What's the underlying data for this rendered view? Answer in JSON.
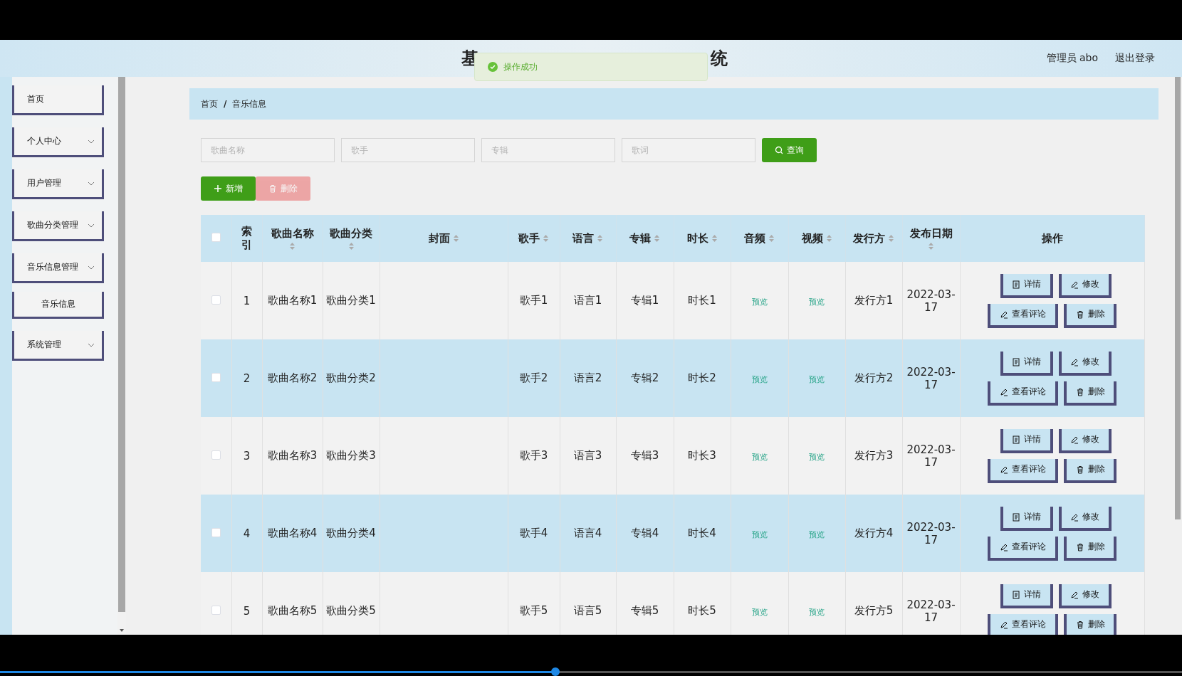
{
  "header": {
    "title_start": "基",
    "title_end": "统",
    "user": "管理员 abo",
    "logout": "退出登录"
  },
  "toast": {
    "message": "操作成功"
  },
  "sidebar": {
    "items": [
      {
        "label": "首页",
        "kind": "link"
      },
      {
        "label": "个人中心",
        "kind": "menu"
      },
      {
        "label": "用户管理",
        "kind": "menu"
      },
      {
        "label": "歌曲分类管理",
        "kind": "menu"
      },
      {
        "label": "音乐信息管理",
        "kind": "menu",
        "children": [
          {
            "label": "音乐信息",
            "kind": "sub"
          }
        ]
      },
      {
        "label": "系统管理",
        "kind": "menu"
      }
    ]
  },
  "breadcrumb": {
    "items": [
      "首页",
      "音乐信息"
    ],
    "separator": "/"
  },
  "search": {
    "fields": [
      {
        "placeholder": "歌曲名称"
      },
      {
        "placeholder": "歌手"
      },
      {
        "placeholder": "专辑"
      },
      {
        "placeholder": "歌词"
      }
    ],
    "button": "查询"
  },
  "actions": [
    {
      "label": "新增",
      "kind": "add",
      "disabled": false
    },
    {
      "label": "删除",
      "kind": "delete",
      "disabled": true
    }
  ],
  "table": {
    "header_checked": false,
    "columns": [
      {
        "label": "索引",
        "sortable": false
      },
      {
        "label": "歌曲名称",
        "sortable": true
      },
      {
        "label": "歌曲分类",
        "sortable": true
      },
      {
        "label": "封面",
        "sortable": true
      },
      {
        "label": "歌手",
        "sortable": true
      },
      {
        "label": "语言",
        "sortable": true
      },
      {
        "label": "专辑",
        "sortable": true
      },
      {
        "label": "时长",
        "sortable": true
      },
      {
        "label": "音频",
        "sortable": true
      },
      {
        "label": "视频",
        "sortable": true
      },
      {
        "label": "发行方",
        "sortable": true
      },
      {
        "label": "发布日期",
        "sortable": true
      },
      {
        "label": "操作",
        "sortable": false
      }
    ],
    "rows": [
      {
        "checked": false,
        "cells": [
          "1",
          "歌曲名称1",
          "歌曲分类1",
          "",
          "歌手1",
          "语言1",
          "专辑1",
          "时长1",
          "预览",
          "预览",
          "发行方1",
          "2022-03-17"
        ],
        "actions": [
          {
            "label": "详情",
            "kind": "detail"
          },
          {
            "label": "修改",
            "kind": "edit"
          },
          {
            "label": "查看评论",
            "kind": "comment"
          },
          {
            "label": "删除",
            "kind": "delete"
          }
        ]
      },
      {
        "checked": false,
        "cells": [
          "2",
          "歌曲名称2",
          "歌曲分类2",
          "",
          "歌手2",
          "语言2",
          "专辑2",
          "时长2",
          "预览",
          "预览",
          "发行方2",
          "2022-03-17"
        ],
        "actions": [
          {
            "label": "详情",
            "kind": "detail"
          },
          {
            "label": "修改",
            "kind": "edit"
          },
          {
            "label": "查看评论",
            "kind": "comment"
          },
          {
            "label": "删除",
            "kind": "delete"
          }
        ]
      },
      {
        "checked": false,
        "cells": [
          "3",
          "歌曲名称3",
          "歌曲分类3",
          "",
          "歌手3",
          "语言3",
          "专辑3",
          "时长3",
          "预览",
          "预览",
          "发行方3",
          "2022-03-17"
        ],
        "actions": [
          {
            "label": "详情",
            "kind": "detail"
          },
          {
            "label": "修改",
            "kind": "edit"
          },
          {
            "label": "查看评论",
            "kind": "comment"
          },
          {
            "label": "删除",
            "kind": "delete"
          }
        ]
      },
      {
        "checked": false,
        "cells": [
          "4",
          "歌曲名称4",
          "歌曲分类4",
          "",
          "歌手4",
          "语言4",
          "专辑4",
          "时长4",
          "预览",
          "预览",
          "发行方4",
          "2022-03-17"
        ],
        "actions": [
          {
            "label": "详情",
            "kind": "detail"
          },
          {
            "label": "修改",
            "kind": "edit"
          },
          {
            "label": "查看评论",
            "kind": "comment"
          },
          {
            "label": "删除",
            "kind": "delete"
          }
        ]
      },
      {
        "checked": false,
        "cells": [
          "5",
          "歌曲名称5",
          "歌曲分类5",
          "",
          "歌手5",
          "语言5",
          "专辑5",
          "时长5",
          "预览",
          "预览",
          "发行方5",
          "2022-03-17"
        ],
        "actions": [
          {
            "label": "详情",
            "kind": "detail"
          },
          {
            "label": "修改",
            "kind": "edit"
          },
          {
            "label": "查看评论",
            "kind": "comment"
          },
          {
            "label": "删除",
            "kind": "delete"
          }
        ]
      }
    ]
  },
  "player": {
    "level": 0.47
  }
}
